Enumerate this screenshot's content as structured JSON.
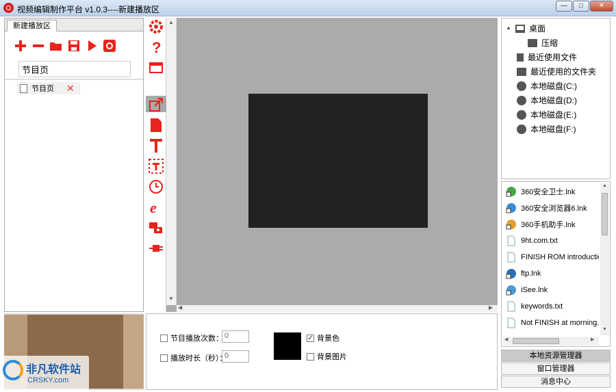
{
  "window": {
    "title": "视频编辑制作平台 v1.0.3----新建播放区",
    "minimize": "—",
    "maximize": "□",
    "close": "✕"
  },
  "left": {
    "tab": "新建播放区",
    "toolbar": [
      "add-icon",
      "remove-icon",
      "folder-open-icon",
      "save-icon",
      "play-icon",
      "record-icon"
    ],
    "program_name": "节目页",
    "page_item": "节目页",
    "colors": {
      "accent": "#e8231c"
    }
  },
  "side_tools": [
    "gear-icon",
    "help-icon",
    "window-icon",
    "export-icon",
    "document-icon",
    "text-icon",
    "text-frame-icon",
    "clock-icon",
    "ie-icon",
    "camera-icon",
    "plug-icon"
  ],
  "bottom": {
    "play_count_label": "节目播放次数：",
    "play_count_value": "0",
    "duration_label": "播放时长（秒）：",
    "duration_value": "0",
    "bg_color_label": "背景色",
    "bg_color_checked": true,
    "bg_image_label": "背景图片",
    "bg_image_checked": false,
    "bg_color": "#000000"
  },
  "tree": [
    {
      "label": "桌面",
      "icon": "monitor-icon"
    },
    {
      "label": "压缩",
      "icon": "folder-icon"
    },
    {
      "label": "最近使用文件",
      "icon": "file-icon"
    },
    {
      "label": "最近使用的文件夹",
      "icon": "folder-icon"
    },
    {
      "label": "本地磁盘(C:)",
      "icon": "disk-icon"
    },
    {
      "label": "本地磁盘(D:)",
      "icon": "disk-icon"
    },
    {
      "label": "本地磁盘(E:)",
      "icon": "disk-icon"
    },
    {
      "label": "本地磁盘(F:)",
      "icon": "disk-icon"
    }
  ],
  "files": [
    {
      "label": "360安全卫士.lnk",
      "icon": "shortcut-icon"
    },
    {
      "label": "360安全浏览器6.lnk",
      "icon": "shortcut-icon"
    },
    {
      "label": "360手机助手.lnk",
      "icon": "shortcut-icon"
    },
    {
      "label": "9ht.com.txt",
      "icon": "text-file-icon"
    },
    {
      "label": "FINISH ROM introductio",
      "icon": "text-file-icon"
    },
    {
      "label": "ftp.lnk",
      "icon": "shortcut-icon"
    },
    {
      "label": "iSee.lnk",
      "icon": "shortcut-icon"
    },
    {
      "label": "keywords.txt",
      "icon": "text-file-icon"
    },
    {
      "label": "Not FINISH at morning.",
      "icon": "text-file-icon"
    }
  ],
  "right_buttons": [
    "本地资源管理器",
    "窗口管理器",
    "消息中心"
  ],
  "watermark": {
    "text": "非凡软件站",
    "sub": "CRSKY.com"
  }
}
